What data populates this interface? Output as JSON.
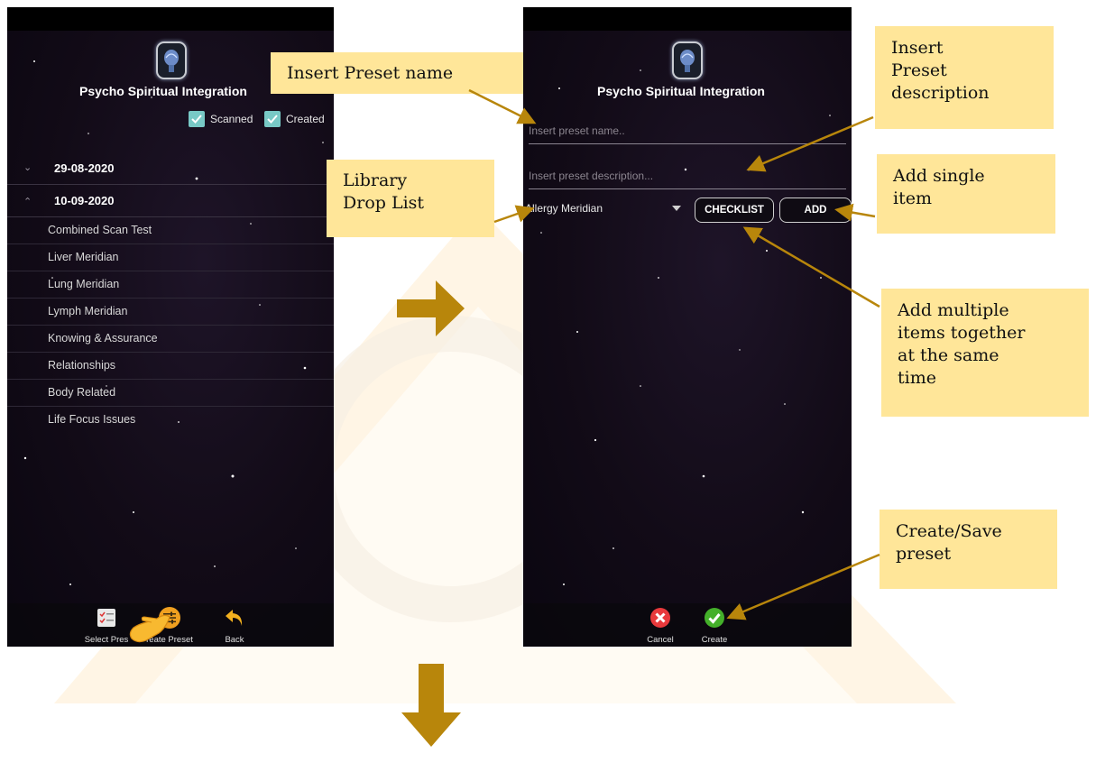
{
  "left_screen": {
    "app_title": "Psycho Spiritual Integration",
    "filters": [
      {
        "label": "Scanned",
        "checked": true
      },
      {
        "label": "Created",
        "checked": true
      }
    ],
    "dates": [
      {
        "date": "29-08-2020",
        "expanded": false
      },
      {
        "date": "10-09-2020",
        "expanded": true
      }
    ],
    "items": [
      "Combined Scan Test",
      "Liver Meridian",
      "Lung Meridian",
      "Lymph Meridian",
      "Knowing & Assurance",
      "Relationships",
      "Body Related",
      "Life Focus Issues"
    ],
    "toolbar": {
      "select_preset": "Select Pres",
      "create_preset": "reate Preset",
      "back": "Back"
    }
  },
  "right_screen": {
    "app_title": "Psycho Spiritual Integration",
    "name_placeholder": "Insert preset name..",
    "description_placeholder": "Insert preset description...",
    "library_selected": "Allergy Meridian",
    "checklist_button": "CHECKLIST",
    "add_button": "ADD",
    "toolbar": {
      "cancel": "Cancel",
      "create": "Create"
    }
  },
  "callouts": {
    "preset_name": "Insert Preset name",
    "library": "Library\nDrop List",
    "preset_description": "Insert\nPreset\ndescription",
    "single_item": "Add single\nitem",
    "multiple_items": "Add multiple\nitems together\nat the same\ntime",
    "create_save": "Create/Save\npreset"
  },
  "colors": {
    "callout_bg": "#ffe699",
    "arrow": "#b8860b",
    "checkbox": "#78c9c6",
    "create_preset_icon": "#f0a020",
    "cancel_icon": "#e8393c",
    "create_icon": "#44b02a",
    "back_icon": "#f2b01e"
  },
  "icons": [
    "brain-logo-icon",
    "check-icon",
    "chevron-down-icon",
    "chevron-up-icon",
    "checklist-icon",
    "sliders-icon",
    "back-arrow-icon",
    "pointing-hand-icon",
    "cancel-icon",
    "confirm-icon",
    "dropdown-caret-icon",
    "flow-arrow-right",
    "flow-arrow-down"
  ]
}
